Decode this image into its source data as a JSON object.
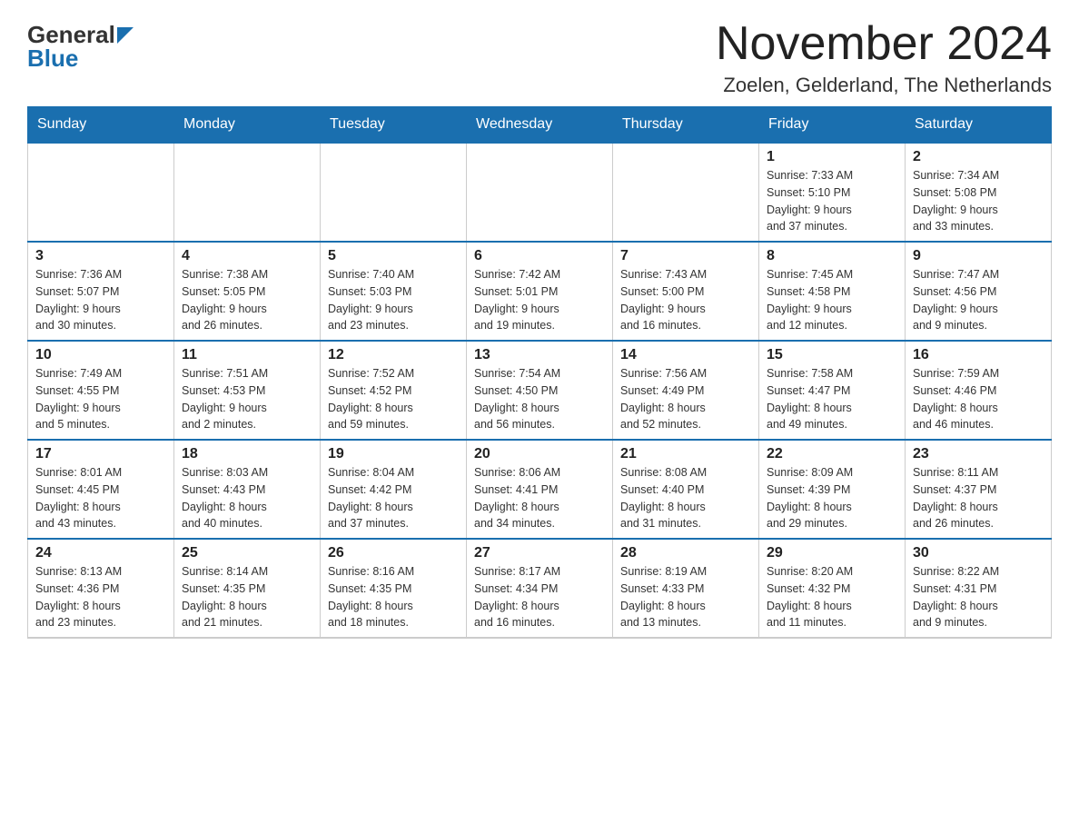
{
  "logo": {
    "general": "General",
    "blue": "Blue"
  },
  "title": "November 2024",
  "location": "Zoelen, Gelderland, The Netherlands",
  "weekdays": [
    "Sunday",
    "Monday",
    "Tuesday",
    "Wednesday",
    "Thursday",
    "Friday",
    "Saturday"
  ],
  "weeks": [
    [
      {
        "day": "",
        "info": ""
      },
      {
        "day": "",
        "info": ""
      },
      {
        "day": "",
        "info": ""
      },
      {
        "day": "",
        "info": ""
      },
      {
        "day": "",
        "info": ""
      },
      {
        "day": "1",
        "info": "Sunrise: 7:33 AM\nSunset: 5:10 PM\nDaylight: 9 hours\nand 37 minutes."
      },
      {
        "day": "2",
        "info": "Sunrise: 7:34 AM\nSunset: 5:08 PM\nDaylight: 9 hours\nand 33 minutes."
      }
    ],
    [
      {
        "day": "3",
        "info": "Sunrise: 7:36 AM\nSunset: 5:07 PM\nDaylight: 9 hours\nand 30 minutes."
      },
      {
        "day": "4",
        "info": "Sunrise: 7:38 AM\nSunset: 5:05 PM\nDaylight: 9 hours\nand 26 minutes."
      },
      {
        "day": "5",
        "info": "Sunrise: 7:40 AM\nSunset: 5:03 PM\nDaylight: 9 hours\nand 23 minutes."
      },
      {
        "day": "6",
        "info": "Sunrise: 7:42 AM\nSunset: 5:01 PM\nDaylight: 9 hours\nand 19 minutes."
      },
      {
        "day": "7",
        "info": "Sunrise: 7:43 AM\nSunset: 5:00 PM\nDaylight: 9 hours\nand 16 minutes."
      },
      {
        "day": "8",
        "info": "Sunrise: 7:45 AM\nSunset: 4:58 PM\nDaylight: 9 hours\nand 12 minutes."
      },
      {
        "day": "9",
        "info": "Sunrise: 7:47 AM\nSunset: 4:56 PM\nDaylight: 9 hours\nand 9 minutes."
      }
    ],
    [
      {
        "day": "10",
        "info": "Sunrise: 7:49 AM\nSunset: 4:55 PM\nDaylight: 9 hours\nand 5 minutes."
      },
      {
        "day": "11",
        "info": "Sunrise: 7:51 AM\nSunset: 4:53 PM\nDaylight: 9 hours\nand 2 minutes."
      },
      {
        "day": "12",
        "info": "Sunrise: 7:52 AM\nSunset: 4:52 PM\nDaylight: 8 hours\nand 59 minutes."
      },
      {
        "day": "13",
        "info": "Sunrise: 7:54 AM\nSunset: 4:50 PM\nDaylight: 8 hours\nand 56 minutes."
      },
      {
        "day": "14",
        "info": "Sunrise: 7:56 AM\nSunset: 4:49 PM\nDaylight: 8 hours\nand 52 minutes."
      },
      {
        "day": "15",
        "info": "Sunrise: 7:58 AM\nSunset: 4:47 PM\nDaylight: 8 hours\nand 49 minutes."
      },
      {
        "day": "16",
        "info": "Sunrise: 7:59 AM\nSunset: 4:46 PM\nDaylight: 8 hours\nand 46 minutes."
      }
    ],
    [
      {
        "day": "17",
        "info": "Sunrise: 8:01 AM\nSunset: 4:45 PM\nDaylight: 8 hours\nand 43 minutes."
      },
      {
        "day": "18",
        "info": "Sunrise: 8:03 AM\nSunset: 4:43 PM\nDaylight: 8 hours\nand 40 minutes."
      },
      {
        "day": "19",
        "info": "Sunrise: 8:04 AM\nSunset: 4:42 PM\nDaylight: 8 hours\nand 37 minutes."
      },
      {
        "day": "20",
        "info": "Sunrise: 8:06 AM\nSunset: 4:41 PM\nDaylight: 8 hours\nand 34 minutes."
      },
      {
        "day": "21",
        "info": "Sunrise: 8:08 AM\nSunset: 4:40 PM\nDaylight: 8 hours\nand 31 minutes."
      },
      {
        "day": "22",
        "info": "Sunrise: 8:09 AM\nSunset: 4:39 PM\nDaylight: 8 hours\nand 29 minutes."
      },
      {
        "day": "23",
        "info": "Sunrise: 8:11 AM\nSunset: 4:37 PM\nDaylight: 8 hours\nand 26 minutes."
      }
    ],
    [
      {
        "day": "24",
        "info": "Sunrise: 8:13 AM\nSunset: 4:36 PM\nDaylight: 8 hours\nand 23 minutes."
      },
      {
        "day": "25",
        "info": "Sunrise: 8:14 AM\nSunset: 4:35 PM\nDaylight: 8 hours\nand 21 minutes."
      },
      {
        "day": "26",
        "info": "Sunrise: 8:16 AM\nSunset: 4:35 PM\nDaylight: 8 hours\nand 18 minutes."
      },
      {
        "day": "27",
        "info": "Sunrise: 8:17 AM\nSunset: 4:34 PM\nDaylight: 8 hours\nand 16 minutes."
      },
      {
        "day": "28",
        "info": "Sunrise: 8:19 AM\nSunset: 4:33 PM\nDaylight: 8 hours\nand 13 minutes."
      },
      {
        "day": "29",
        "info": "Sunrise: 8:20 AM\nSunset: 4:32 PM\nDaylight: 8 hours\nand 11 minutes."
      },
      {
        "day": "30",
        "info": "Sunrise: 8:22 AM\nSunset: 4:31 PM\nDaylight: 8 hours\nand 9 minutes."
      }
    ]
  ]
}
